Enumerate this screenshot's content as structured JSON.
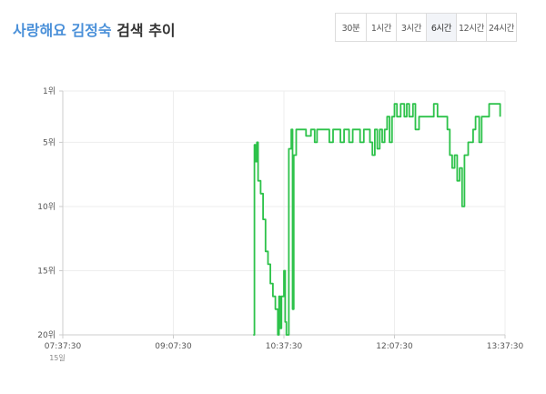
{
  "header": {
    "title_highlight": "사랑해요 김정숙",
    "title_rest": " 검색 추이",
    "ranges": [
      "30분",
      "1시간",
      "3시간",
      "6시간",
      "12시간",
      "24시간"
    ],
    "active_range": "6시간"
  },
  "colors": {
    "line": "#2dc24a",
    "title_highlight": "#4a90d9",
    "grid": "#eeeeee",
    "axis": "#cccccc"
  },
  "chart_data": {
    "type": "line",
    "title": "",
    "xlabel": "",
    "ylabel": "",
    "date_label": "15일",
    "x_ticks": [
      "07:37:30",
      "09:07:30",
      "10:37:30",
      "12:07:30",
      "13:37:30"
    ],
    "y_ticks": [
      "1위",
      "5위",
      "10위",
      "15위",
      "20위"
    ],
    "y_tick_values": [
      1,
      5,
      10,
      15,
      20
    ],
    "ylim": [
      1,
      20
    ],
    "y_inverted": true,
    "grid": true,
    "x_unit": "minutes from 07:37:30",
    "xlim": [
      0,
      360
    ],
    "series": [
      {
        "name": "",
        "points": [
          [
            155,
            20
          ],
          [
            156,
            5.2
          ],
          [
            157,
            6.5
          ],
          [
            158,
            5
          ],
          [
            159,
            8
          ],
          [
            161,
            9
          ],
          [
            163,
            11
          ],
          [
            165,
            13.5
          ],
          [
            167,
            14.5
          ],
          [
            169,
            16
          ],
          [
            171,
            17
          ],
          [
            173,
            18
          ],
          [
            175,
            20
          ],
          [
            176,
            17
          ],
          [
            177,
            19.5
          ],
          [
            178,
            17
          ],
          [
            180,
            15
          ],
          [
            181,
            19
          ],
          [
            182,
            20
          ],
          [
            184,
            5.5
          ],
          [
            186,
            4
          ],
          [
            187,
            18
          ],
          [
            188,
            6
          ],
          [
            190,
            4
          ],
          [
            194,
            4
          ],
          [
            198,
            4.5
          ],
          [
            202,
            4
          ],
          [
            205,
            5
          ],
          [
            207,
            4
          ],
          [
            215,
            4
          ],
          [
            217,
            5
          ],
          [
            220,
            4
          ],
          [
            224,
            4
          ],
          [
            226,
            5
          ],
          [
            229,
            4
          ],
          [
            233,
            5
          ],
          [
            236,
            4
          ],
          [
            240,
            4
          ],
          [
            242,
            5
          ],
          [
            245,
            4
          ],
          [
            248,
            4
          ],
          [
            250,
            5
          ],
          [
            252,
            6
          ],
          [
            254,
            4
          ],
          [
            256,
            5.5
          ],
          [
            258,
            4
          ],
          [
            260,
            5
          ],
          [
            262,
            4
          ],
          [
            264,
            3
          ],
          [
            266,
            5
          ],
          [
            268,
            3
          ],
          [
            270,
            2
          ],
          [
            272,
            3
          ],
          [
            275,
            2
          ],
          [
            278,
            3
          ],
          [
            280,
            2
          ],
          [
            282,
            3
          ],
          [
            285,
            2
          ],
          [
            287,
            4
          ],
          [
            290,
            3
          ],
          [
            300,
            3
          ],
          [
            302,
            2
          ],
          [
            305,
            3
          ],
          [
            310,
            3
          ],
          [
            313,
            4
          ],
          [
            315,
            6
          ],
          [
            317,
            7
          ],
          [
            319,
            6
          ],
          [
            321,
            8
          ],
          [
            323,
            7
          ],
          [
            325,
            10
          ],
          [
            327,
            6
          ],
          [
            330,
            5
          ],
          [
            332,
            5
          ],
          [
            334,
            4
          ],
          [
            336,
            3
          ],
          [
            338,
            3
          ],
          [
            339,
            5
          ],
          [
            341,
            3
          ],
          [
            345,
            3
          ],
          [
            347,
            2
          ],
          [
            350,
            2
          ],
          [
            355,
            2
          ],
          [
            356,
            3
          ]
        ]
      }
    ]
  }
}
